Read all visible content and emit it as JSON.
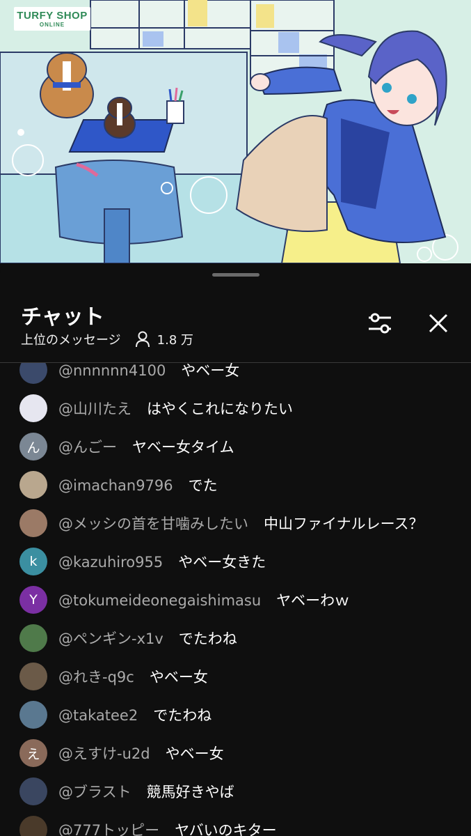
{
  "video": {
    "logo_line1": "TURFY SHOP",
    "logo_line2": "ONLINE"
  },
  "chat": {
    "title": "チャット",
    "mode": "上位のメッセージ",
    "viewer_count": "1.8 万",
    "icons": {
      "filter": "sliders-icon",
      "close": "close-icon",
      "viewers": "person-icon"
    },
    "messages": [
      {
        "author": "@nnnnnn4100",
        "text": "やベー女",
        "avatar_letter": "",
        "avatar_color": "#3b4a6b"
      },
      {
        "author": "@山川たえ",
        "text": "はやくこれになりたい",
        "avatar_letter": "",
        "avatar_color": "#e6e6f0"
      },
      {
        "author": "@んごー",
        "text": "ヤベー女タイム",
        "avatar_letter": "ん",
        "avatar_color": "#7b8794"
      },
      {
        "author": "@imachan9796",
        "text": "でた",
        "avatar_letter": "",
        "avatar_color": "#b9a78e"
      },
      {
        "author": "@メッシの首を甘噛みしたい",
        "text": "中山ファイナルレース？",
        "avatar_letter": "",
        "avatar_color": "#9b7a66"
      },
      {
        "author": "@kazuhiro955",
        "text": "やベー女きた",
        "avatar_letter": "k",
        "avatar_color": "#3b8fa1"
      },
      {
        "author": "@tokumeideonegaishimasu",
        "text": "ヤベーわｗ",
        "avatar_letter": "Y",
        "avatar_color": "#7b2fa3"
      },
      {
        "author": "@ペンギン-x1v",
        "text": "でたわね",
        "avatar_letter": "",
        "avatar_color": "#4f7a4a"
      },
      {
        "author": "@れき-q9c",
        "text": "やベー女",
        "avatar_letter": "",
        "avatar_color": "#6b5a48"
      },
      {
        "author": "@takatee2",
        "text": "でたわね",
        "avatar_letter": "",
        "avatar_color": "#5a7890"
      },
      {
        "author": "@えすけ-u2d",
        "text": "やベー女",
        "avatar_letter": "え",
        "avatar_color": "#8a6a5a"
      },
      {
        "author": "@ブラスト",
        "text": "競馬好きやば",
        "avatar_letter": "",
        "avatar_color": "#3a4660"
      },
      {
        "author": "@777トッピー",
        "text": "ヤバいのキター",
        "avatar_letter": "",
        "avatar_color": "#4a3a2a"
      }
    ]
  }
}
